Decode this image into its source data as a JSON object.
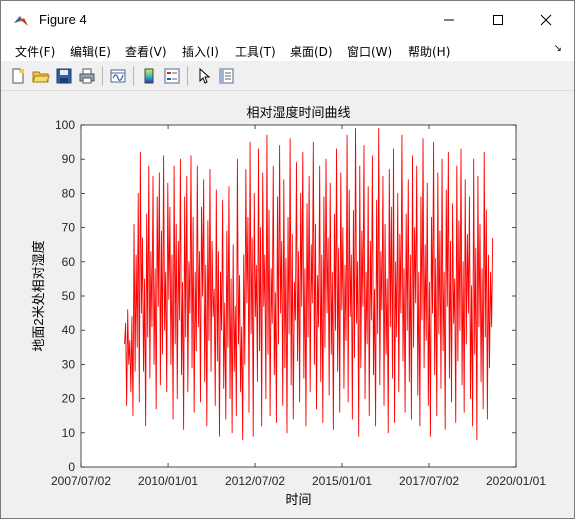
{
  "window": {
    "title": "Figure 4"
  },
  "menu": {
    "items": [
      "文件(F)",
      "编辑(E)",
      "查看(V)",
      "插入(I)",
      "工具(T)",
      "桌面(D)",
      "窗口(W)",
      "帮助(H)"
    ]
  },
  "toolbar": {
    "icons": [
      "new-figure-icon",
      "open-file-icon",
      "save-icon",
      "print-icon",
      "link-plot-icon",
      "colorbar-icon",
      "legend-icon",
      "pointer-icon",
      "property-editor-icon"
    ]
  },
  "colors": {
    "series": "#ff0000",
    "axes": "#262626"
  },
  "chart_data": {
    "type": "line",
    "title": "相对湿度时间曲线",
    "xlabel": "时间",
    "ylabel": "地面2米处相对湿度",
    "xlim": [
      "2007/07/02",
      "2020/01/01"
    ],
    "ylim": [
      0,
      100
    ],
    "xticks": [
      "2007/07/02",
      "2010/01/01",
      "2012/07/02",
      "2015/01/01",
      "2017/07/02",
      "2020/01/01"
    ],
    "yticks": [
      0,
      10,
      20,
      30,
      40,
      50,
      60,
      70,
      80,
      90,
      100
    ],
    "grid": false,
    "series": [
      {
        "x_start": "2008/10/01",
        "x_end": "2019/05/01",
        "values": [
          36,
          42,
          18,
          46,
          30,
          37,
          22,
          44,
          15,
          71,
          28,
          62,
          35,
          80,
          19,
          92,
          45,
          67,
          28,
          55,
          12,
          74,
          38,
          88,
          26,
          63,
          41,
          85,
          30,
          58,
          17,
          79,
          47,
          86,
          24,
          69,
          33,
          91,
          40,
          57,
          22,
          83,
          49,
          76,
          30,
          62,
          14,
          88,
          36,
          71,
          20,
          66,
          43,
          90,
          27,
          54,
          11,
          79,
          38,
          85,
          22,
          60,
          45,
          91,
          29,
          73,
          16,
          57,
          34,
          88,
          41,
          63,
          19,
          76,
          50,
          84,
          25,
          59,
          12,
          72,
          37,
          87,
          28,
          66,
          44,
          52,
          18,
          81,
          31,
          63,
          9,
          57,
          40,
          78,
          23,
          48,
          14,
          69,
          35,
          82,
          20,
          55,
          10,
          65,
          28,
          47,
          15,
          90,
          36,
          56,
          22,
          41,
          8,
          62,
          30,
          87,
          48,
          73,
          16,
          95,
          39,
          67,
          9,
          80,
          44,
          59,
          25,
          93,
          34,
          70,
          12,
          86,
          47,
          62,
          20,
          97,
          33,
          75,
          15,
          58,
          42,
          88,
          27,
          51,
          13,
          79,
          36,
          94,
          45,
          66,
          18,
          84,
          29,
          61,
          10,
          73,
          39,
          96,
          24,
          68,
          14,
          54,
          43,
          89,
          31,
          63,
          19,
          80,
          47,
          92,
          26,
          58,
          12,
          77,
          38,
          85,
          22,
          65,
          48,
          95,
          30,
          71,
          17,
          56,
          41,
          88,
          25,
          62,
          13,
          79,
          35,
          90,
          45,
          67,
          21,
          83,
          33,
          57,
          11,
          74,
          40,
          93,
          28,
          64,
          16,
          86,
          46,
          70,
          23,
          59,
          37,
          97,
          19,
          81,
          44,
          62,
          14,
          75,
          32,
          99,
          42,
          60,
          9,
          88,
          29,
          69,
          47,
          94,
          20,
          57,
          36,
          82,
          15,
          66,
          43,
          91,
          27,
          52,
          12,
          78,
          39,
          99,
          24,
          63,
          46,
          85,
          18,
          71,
          33,
          55,
          10,
          87,
          41,
          76,
          26,
          93,
          13,
          60,
          38,
          80,
          22,
          68,
          45,
          97,
          31,
          58,
          16,
          74,
          40,
          84,
          25,
          62,
          14,
          91,
          35,
          70,
          48,
          88,
          21,
          57,
          12,
          79,
          43,
          96,
          29,
          65,
          37,
          83,
          18,
          54,
          9,
          73,
          45,
          95,
          27,
          61,
          15,
          86,
          39,
          69,
          23,
          90,
          34,
          57,
          11,
          81,
          47,
          92,
          26,
          66,
          19,
          77,
          42,
          55,
          13,
          88,
          31,
          72,
          40,
          93,
          24,
          60,
          16,
          84,
          36,
          68,
          45,
          79,
          20,
          53,
          12,
          90,
          33,
          64,
          8,
          85,
          41,
          71,
          25,
          58,
          17,
          92,
          38,
          75,
          14,
          62,
          29,
          57,
          41,
          67
        ]
      }
    ]
  }
}
